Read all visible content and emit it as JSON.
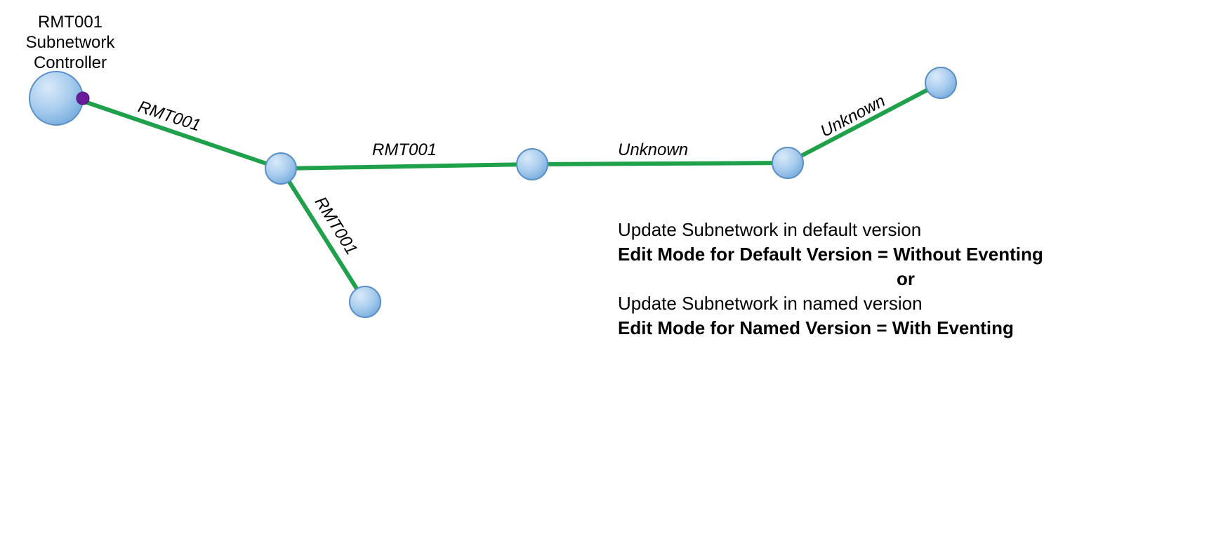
{
  "controller_label": {
    "line1": "RMT001",
    "line2": "Subnetwork",
    "line3": "Controller"
  },
  "edges": {
    "e1": "RMT001",
    "e2": "RMT001",
    "e3": "RMT001",
    "e4": "Unknown",
    "e5": "Unknown"
  },
  "info": {
    "l1": "Update Subnetwork in default version",
    "l2": "Edit Mode for Default Version = Without Eventing",
    "l3": "or",
    "l4": "Update Subnetwork in named version",
    "l5": "Edit Mode for Named Version = With Eventing"
  },
  "colors": {
    "edge": "#1fa04a",
    "node_fill": "#a9cdee",
    "node_stroke": "#5a8fc7",
    "controller_dot": "#6a1b9a"
  }
}
